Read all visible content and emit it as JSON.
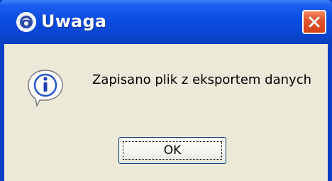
{
  "dialog": {
    "title": "Uwaga",
    "message": "Zapisano plik z eksportem danych",
    "ok_label": "OK",
    "icons": {
      "app": "app-icon",
      "close": "close-icon",
      "message": "info-icon"
    }
  }
}
